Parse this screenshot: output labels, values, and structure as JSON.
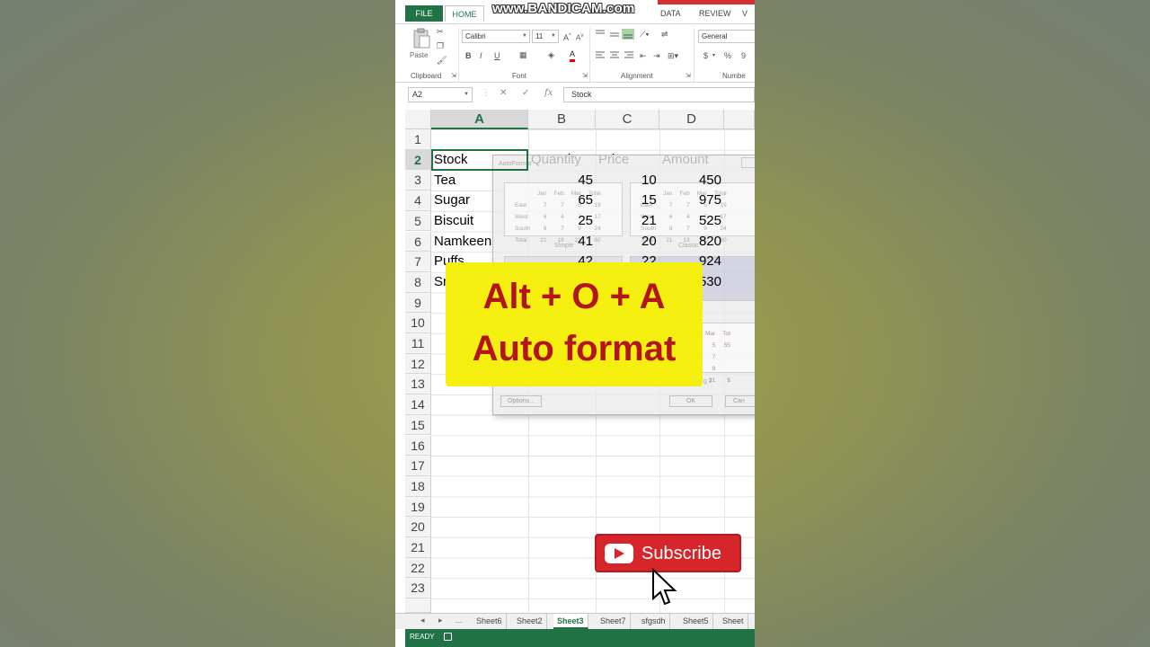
{
  "watermark": "www.BANDICAM.com",
  "ribbon_tabs": {
    "file": "FILE",
    "home": "HOME",
    "data": "DATA",
    "review": "REVIEW",
    "overflow": "V"
  },
  "ribbon": {
    "paste_label": "Paste",
    "font_name": "Calibri",
    "font_size": "11",
    "number_format": "General",
    "groups": {
      "clipboard": "Clipboard",
      "font": "Font",
      "alignment": "Alignment",
      "number": "Numbe"
    },
    "bold": "B",
    "italic": "I",
    "underline": "U",
    "currency": "$",
    "percent": "%",
    "comma": "9"
  },
  "formula_bar": {
    "name_box": "A2",
    "fx": "fx",
    "content": "Stock"
  },
  "columns": [
    "A",
    "B",
    "C",
    "D"
  ],
  "rows": [
    "1",
    "2",
    "3",
    "4",
    "5",
    "6",
    "7",
    "8",
    "9",
    "10",
    "11",
    "12",
    "13",
    "14",
    "15",
    "16",
    "17",
    "18",
    "19",
    "20",
    "21",
    "22",
    "23"
  ],
  "table": {
    "headers": [
      "Stock",
      "Quantity",
      "Price",
      "Amount"
    ],
    "rows": [
      {
        "stock": "Tea",
        "quantity": "45",
        "price": "10",
        "amount": "450"
      },
      {
        "stock": "Sugar",
        "quantity": "65",
        "price": "15",
        "amount": "975"
      },
      {
        "stock": "Biscuit",
        "quantity": "25",
        "price": "21",
        "amount": "525"
      },
      {
        "stock": "Namkeen",
        "quantity": "41",
        "price": "20",
        "amount": "820"
      },
      {
        "stock": "Puffs",
        "quantity": "42",
        "price": "22",
        "amount": "924"
      },
      {
        "stock": "Sn",
        "quantity": "",
        "price": "",
        "amount": "530"
      }
    ]
  },
  "dialog": {
    "title": "AutoFormat",
    "samples": [
      {
        "name": "Simple",
        "header": [
          "Jan",
          "Feb",
          "Mar",
          "Total"
        ],
        "rows": [
          [
            "East",
            "7",
            "7",
            "5",
            "19"
          ],
          [
            "West",
            "6",
            "4",
            "7",
            "17"
          ],
          [
            "South",
            "8",
            "7",
            "9",
            "24"
          ],
          [
            "Total",
            "21",
            "18",
            "21",
            "60"
          ]
        ]
      },
      {
        "name": "Classic",
        "header": [
          "Jan",
          "Feb",
          "Mar",
          "Total"
        ],
        "rows": [
          [
            "East",
            "7",
            "7",
            "5",
            "19"
          ],
          [
            "West",
            "6",
            "4",
            "7",
            "17"
          ],
          [
            "South",
            "8",
            "7",
            "9",
            "24"
          ],
          [
            "Total",
            "21",
            "18",
            "21",
            "60"
          ]
        ]
      }
    ],
    "partial_sample": {
      "header": [
        "Mar",
        "Tot"
      ],
      "rows": [
        [
          "5",
          "55"
        ],
        [
          "7",
          ""
        ],
        [
          "9",
          ""
        ],
        [
          "21",
          "$"
        ]
      ]
    },
    "partial_name": "g 2",
    "options_button": "Options...",
    "ok_button": "OK",
    "cancel_button": "Can"
  },
  "overlay": {
    "line1": "Alt + O + A",
    "line2": "Auto format"
  },
  "subscribe": {
    "label": "Subscribe"
  },
  "sheet_tabs": {
    "ellipsis": "...",
    "tabs": [
      "Sheet6",
      "Sheet2",
      "Sheet3",
      "Sheet7",
      "sfgsdh",
      "Sheet5",
      "Sheet"
    ],
    "active": "Sheet3"
  },
  "status": {
    "text": "READY"
  },
  "colors": {
    "excel_green": "#217346",
    "callout_bg": "#f5ef10",
    "callout_text": "#b3151c",
    "subscribe_red": "#d7262b"
  }
}
